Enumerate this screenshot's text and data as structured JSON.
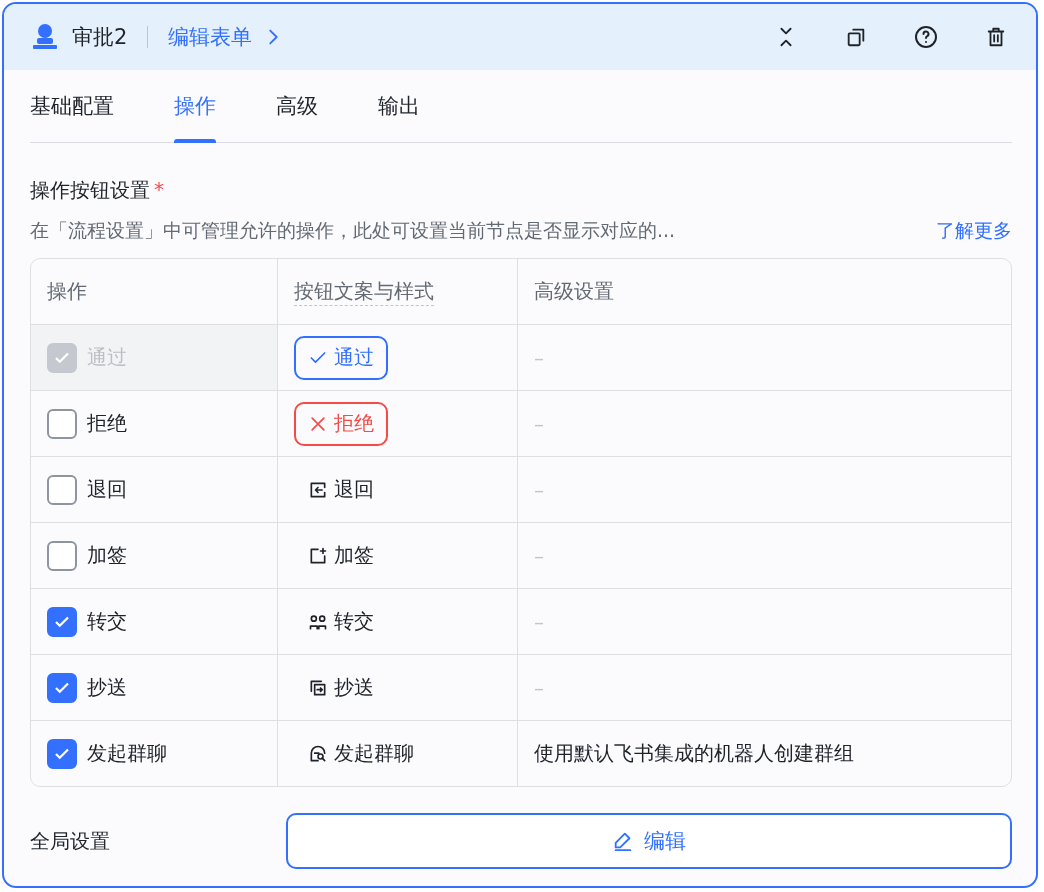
{
  "header": {
    "title": "审批2",
    "link": "编辑表单"
  },
  "tabs": [
    {
      "label": "基础配置",
      "selected": false
    },
    {
      "label": "操作",
      "selected": true
    },
    {
      "label": "高级",
      "selected": false
    },
    {
      "label": "输出",
      "selected": false
    }
  ],
  "section": {
    "title": "操作按钮设置",
    "required_mark": "*",
    "description": "在「流程设置」中可管理允许的操作，此处可设置当前节点是否显示对应的...",
    "more_link": "了解更多"
  },
  "table": {
    "columns": [
      "操作",
      "按钮文案与样式",
      "高级设置"
    ],
    "rows": [
      {
        "label": "通过",
        "checked": true,
        "disabled": true,
        "button": {
          "text": "通过",
          "kind": "approve"
        },
        "advanced": "–"
      },
      {
        "label": "拒绝",
        "checked": false,
        "disabled": false,
        "button": {
          "text": "拒绝",
          "kind": "reject"
        },
        "advanced": "–"
      },
      {
        "label": "退回",
        "checked": false,
        "disabled": false,
        "button": {
          "text": "退回",
          "kind": "return"
        },
        "advanced": "–"
      },
      {
        "label": "加签",
        "checked": false,
        "disabled": false,
        "button": {
          "text": "加签",
          "kind": "add"
        },
        "advanced": "–"
      },
      {
        "label": "转交",
        "checked": true,
        "disabled": false,
        "button": {
          "text": "转交",
          "kind": "transfer"
        },
        "advanced": "–"
      },
      {
        "label": "抄送",
        "checked": true,
        "disabled": false,
        "button": {
          "text": "抄送",
          "kind": "copy"
        },
        "advanced": "–"
      },
      {
        "label": "发起群聊",
        "checked": true,
        "disabled": false,
        "button": {
          "text": "发起群聊",
          "kind": "chat"
        },
        "advanced": "使用默认飞书集成的机器人创建群组"
      }
    ]
  },
  "footer": {
    "label": "全局设置",
    "button": "编辑"
  }
}
